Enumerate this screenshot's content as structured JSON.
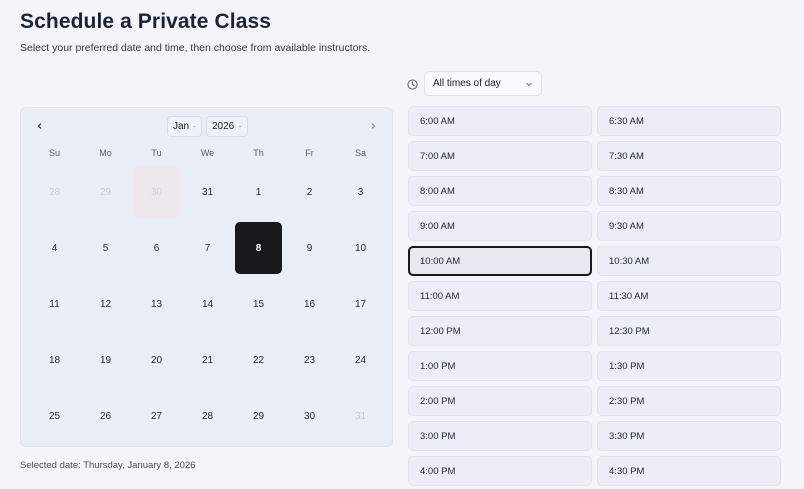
{
  "header": {
    "title": "Schedule a Private Class",
    "subtitle": "Select your preferred date and time, then choose from available instructors."
  },
  "filter": {
    "icon": "clock-icon",
    "selected": "All times of day"
  },
  "calendar": {
    "month": "Jan",
    "year": "2026",
    "weekdays": [
      "Su",
      "Mo",
      "Tu",
      "We",
      "Th",
      "Fr",
      "Sa"
    ],
    "days": [
      {
        "label": "28",
        "state": "muted"
      },
      {
        "label": "29",
        "state": "muted"
      },
      {
        "label": "30",
        "state": "today-soft"
      },
      {
        "label": "31",
        "state": "normal"
      },
      {
        "label": "1",
        "state": "normal"
      },
      {
        "label": "2",
        "state": "normal"
      },
      {
        "label": "3",
        "state": "normal"
      },
      {
        "label": "4",
        "state": "normal"
      },
      {
        "label": "5",
        "state": "normal"
      },
      {
        "label": "6",
        "state": "normal"
      },
      {
        "label": "7",
        "state": "normal"
      },
      {
        "label": "8",
        "state": "selected"
      },
      {
        "label": "9",
        "state": "normal"
      },
      {
        "label": "10",
        "state": "normal"
      },
      {
        "label": "11",
        "state": "normal"
      },
      {
        "label": "12",
        "state": "normal"
      },
      {
        "label": "13",
        "state": "normal"
      },
      {
        "label": "14",
        "state": "normal"
      },
      {
        "label": "15",
        "state": "normal"
      },
      {
        "label": "16",
        "state": "normal"
      },
      {
        "label": "17",
        "state": "normal"
      },
      {
        "label": "18",
        "state": "normal"
      },
      {
        "label": "19",
        "state": "normal"
      },
      {
        "label": "20",
        "state": "normal"
      },
      {
        "label": "21",
        "state": "normal"
      },
      {
        "label": "22",
        "state": "normal"
      },
      {
        "label": "23",
        "state": "normal"
      },
      {
        "label": "24",
        "state": "normal"
      },
      {
        "label": "25",
        "state": "normal"
      },
      {
        "label": "26",
        "state": "normal"
      },
      {
        "label": "27",
        "state": "normal"
      },
      {
        "label": "28",
        "state": "normal"
      },
      {
        "label": "29",
        "state": "normal"
      },
      {
        "label": "30",
        "state": "normal"
      },
      {
        "label": "31",
        "state": "muted"
      }
    ]
  },
  "selection": {
    "text": "Selected date: Thursday, January 8, 2026"
  },
  "time_slots": [
    {
      "label": "6:00 AM",
      "active": false
    },
    {
      "label": "6:30 AM",
      "active": false
    },
    {
      "label": "7:00 AM",
      "active": false
    },
    {
      "label": "7:30 AM",
      "active": false
    },
    {
      "label": "8:00 AM",
      "active": false
    },
    {
      "label": "8:30 AM",
      "active": false
    },
    {
      "label": "9:00 AM",
      "active": false
    },
    {
      "label": "9:30 AM",
      "active": false
    },
    {
      "label": "10:00 AM",
      "active": true
    },
    {
      "label": "10:30 AM",
      "active": false
    },
    {
      "label": "11:00 AM",
      "active": false
    },
    {
      "label": "11:30 AM",
      "active": false
    },
    {
      "label": "12:00 PM",
      "active": false
    },
    {
      "label": "12:30 PM",
      "active": false
    },
    {
      "label": "1:00 PM",
      "active": false
    },
    {
      "label": "1:30 PM",
      "active": false
    },
    {
      "label": "2:00 PM",
      "active": false
    },
    {
      "label": "2:30 PM",
      "active": false
    },
    {
      "label": "3:00 PM",
      "active": false
    },
    {
      "label": "3:30 PM",
      "active": false
    },
    {
      "label": "4:00 PM",
      "active": false
    },
    {
      "label": "4:30 PM",
      "active": false
    }
  ],
  "colors": {
    "selected_day": "#17181c",
    "panel": "#e9edf6",
    "active_slot_border": "#16181d"
  }
}
